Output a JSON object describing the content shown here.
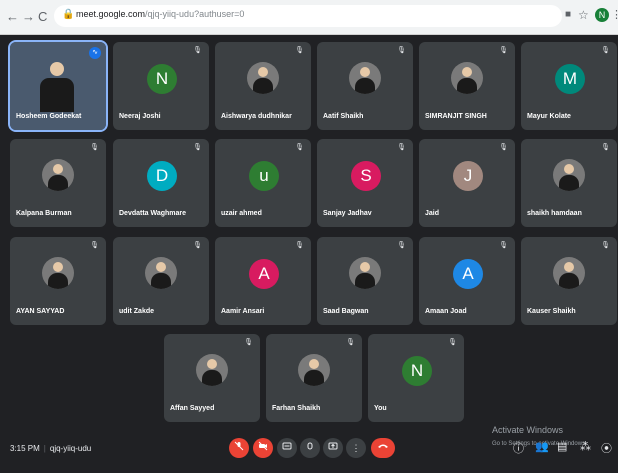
{
  "browser": {
    "back": "←",
    "forward": "→",
    "reload": "C",
    "url_host": "meet.google.com",
    "url_path": "/qjq-yiiq-udu?authuser=0",
    "profile_initial": "N"
  },
  "participants": [
    {
      "name": "Hosheem Godeekat",
      "kind": "photo"
    },
    {
      "name": "Neeraj Joshi",
      "kind": "initial",
      "initial": "N",
      "color": "#2e7d32"
    },
    {
      "name": "Aishwarya dudhnikar",
      "kind": "photo"
    },
    {
      "name": "Aatif Shaikh",
      "kind": "photo"
    },
    {
      "name": "SIMRANJIT SINGH",
      "kind": "photo"
    },
    {
      "name": "Mayur Kolate",
      "kind": "initial",
      "initial": "M",
      "color": "#00897b"
    },
    {
      "name": "Kalpana Burman",
      "kind": "photo"
    },
    {
      "name": "Devdatta Waghmare",
      "kind": "initial",
      "initial": "D",
      "color": "#00acc1"
    },
    {
      "name": "uzair ahmed",
      "kind": "initial",
      "initial": "u",
      "color": "#2e7d32"
    },
    {
      "name": "Sanjay Jadhav",
      "kind": "initial",
      "initial": "S",
      "color": "#d81b60"
    },
    {
      "name": "Jaid",
      "kind": "initial",
      "initial": "J",
      "color": "#a1887f"
    },
    {
      "name": "shaikh hamdaan",
      "kind": "photo"
    },
    {
      "name": "AYAN SAYYAD",
      "kind": "photo"
    },
    {
      "name": "udit Zakde",
      "kind": "photo"
    },
    {
      "name": "Aamir Ansari",
      "kind": "initial",
      "initial": "A",
      "color": "#d81b60"
    },
    {
      "name": "Saad Bagwan",
      "kind": "photo"
    },
    {
      "name": "Amaan Joad",
      "kind": "initial",
      "initial": "A",
      "color": "#1e88e5"
    },
    {
      "name": "Kauser Shaikh",
      "kind": "photo"
    },
    {
      "name": "Affan Sayyed",
      "kind": "photo"
    },
    {
      "name": "Farhan Shaikh",
      "kind": "photo"
    },
    {
      "name": "You",
      "kind": "initial",
      "initial": "N",
      "color": "#2e7d32"
    }
  ],
  "meeting": {
    "time": "3:15 PM",
    "separator": "|",
    "code": "qjq-yiiq-udu"
  },
  "watermark": {
    "line1": "Activate Windows",
    "line2": "Go to Settings to activate Windows."
  },
  "icons": {
    "mic_off": "mic-off-icon",
    "cam_off": "camera-off-icon",
    "captions": "captions-icon",
    "hand": "raise-hand-icon",
    "present": "present-icon",
    "more": "more-options-icon",
    "end": "end-call-icon",
    "info": "meeting-details-icon",
    "people": "people-icon",
    "chat": "chat-icon",
    "activities": "activities-icon",
    "lock": "host-controls-icon"
  }
}
